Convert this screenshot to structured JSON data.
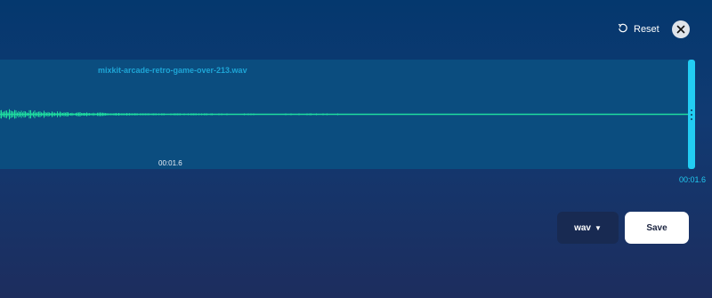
{
  "toolbar": {
    "reset_label": "Reset",
    "reset_icon": "reset-icon",
    "close_icon": "close-icon"
  },
  "track": {
    "filename": "mixkit-arcade-retro-game-over-213.wav",
    "current_time": "00:01.6",
    "end_time": "00:01.6",
    "wave_color": "#1fdc9f",
    "handle_color": "#22cdf3"
  },
  "export": {
    "format_value": "wav",
    "format_caret": "▼",
    "save_label": "Save"
  }
}
